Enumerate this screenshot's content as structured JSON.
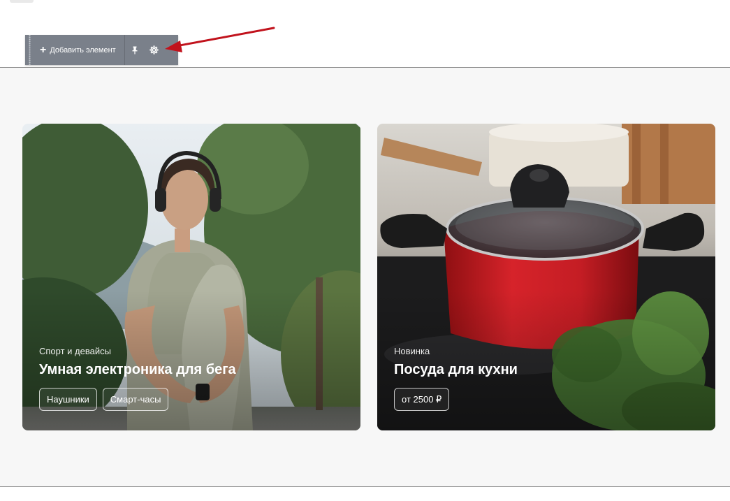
{
  "toolbar": {
    "add_label": "Добавить элемент",
    "add_icon": "plus-icon",
    "pin_icon": "pin-icon",
    "settings_icon": "gear-icon"
  },
  "cards": [
    {
      "category": "Спорт и девайсы",
      "title": "Умная электроника для бега",
      "chips": [
        "Наушники",
        "Смарт-часы"
      ]
    },
    {
      "category": "Новинка",
      "title": "Посуда для кухни",
      "chips": [
        "от 2500 ₽"
      ]
    }
  ],
  "colors": {
    "toolbar_bg": "#7a808a",
    "annotation_arrow": "#c1121c",
    "section_bg": "#f7f7f7"
  }
}
